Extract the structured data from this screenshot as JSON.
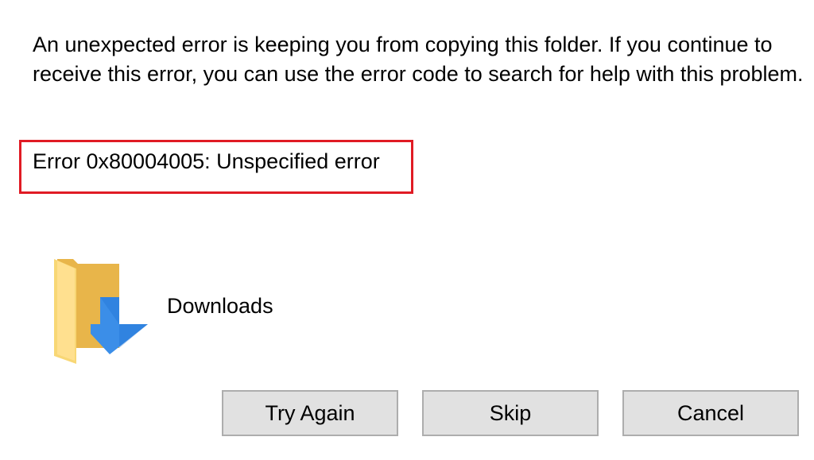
{
  "dialog": {
    "message": "An unexpected error is keeping you from copying this folder. If you continue to receive this error, you can use the error code to search for help with this problem.",
    "error_code": "Error 0x80004005: Unspecified error",
    "highlight_color": "#e01b24",
    "item": {
      "name": "Downloads",
      "icon": "downloads-folder-icon"
    },
    "buttons": {
      "try_again": "Try Again",
      "skip": "Skip",
      "cancel": "Cancel"
    }
  }
}
